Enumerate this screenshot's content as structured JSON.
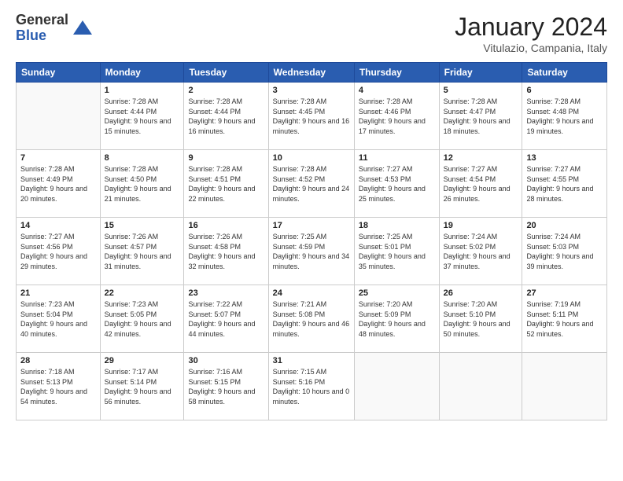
{
  "logo": {
    "general": "General",
    "blue": "Blue"
  },
  "title": "January 2024",
  "subtitle": "Vitulazio, Campania, Italy",
  "headers": [
    "Sunday",
    "Monday",
    "Tuesday",
    "Wednesday",
    "Thursday",
    "Friday",
    "Saturday"
  ],
  "weeks": [
    [
      {
        "num": "",
        "sunrise": "",
        "sunset": "",
        "daylight": ""
      },
      {
        "num": "1",
        "sunrise": "Sunrise: 7:28 AM",
        "sunset": "Sunset: 4:44 PM",
        "daylight": "Daylight: 9 hours and 15 minutes."
      },
      {
        "num": "2",
        "sunrise": "Sunrise: 7:28 AM",
        "sunset": "Sunset: 4:44 PM",
        "daylight": "Daylight: 9 hours and 16 minutes."
      },
      {
        "num": "3",
        "sunrise": "Sunrise: 7:28 AM",
        "sunset": "Sunset: 4:45 PM",
        "daylight": "Daylight: 9 hours and 16 minutes."
      },
      {
        "num": "4",
        "sunrise": "Sunrise: 7:28 AM",
        "sunset": "Sunset: 4:46 PM",
        "daylight": "Daylight: 9 hours and 17 minutes."
      },
      {
        "num": "5",
        "sunrise": "Sunrise: 7:28 AM",
        "sunset": "Sunset: 4:47 PM",
        "daylight": "Daylight: 9 hours and 18 minutes."
      },
      {
        "num": "6",
        "sunrise": "Sunrise: 7:28 AM",
        "sunset": "Sunset: 4:48 PM",
        "daylight": "Daylight: 9 hours and 19 minutes."
      }
    ],
    [
      {
        "num": "7",
        "sunrise": "Sunrise: 7:28 AM",
        "sunset": "Sunset: 4:49 PM",
        "daylight": "Daylight: 9 hours and 20 minutes."
      },
      {
        "num": "8",
        "sunrise": "Sunrise: 7:28 AM",
        "sunset": "Sunset: 4:50 PM",
        "daylight": "Daylight: 9 hours and 21 minutes."
      },
      {
        "num": "9",
        "sunrise": "Sunrise: 7:28 AM",
        "sunset": "Sunset: 4:51 PM",
        "daylight": "Daylight: 9 hours and 22 minutes."
      },
      {
        "num": "10",
        "sunrise": "Sunrise: 7:28 AM",
        "sunset": "Sunset: 4:52 PM",
        "daylight": "Daylight: 9 hours and 24 minutes."
      },
      {
        "num": "11",
        "sunrise": "Sunrise: 7:27 AM",
        "sunset": "Sunset: 4:53 PM",
        "daylight": "Daylight: 9 hours and 25 minutes."
      },
      {
        "num": "12",
        "sunrise": "Sunrise: 7:27 AM",
        "sunset": "Sunset: 4:54 PM",
        "daylight": "Daylight: 9 hours and 26 minutes."
      },
      {
        "num": "13",
        "sunrise": "Sunrise: 7:27 AM",
        "sunset": "Sunset: 4:55 PM",
        "daylight": "Daylight: 9 hours and 28 minutes."
      }
    ],
    [
      {
        "num": "14",
        "sunrise": "Sunrise: 7:27 AM",
        "sunset": "Sunset: 4:56 PM",
        "daylight": "Daylight: 9 hours and 29 minutes."
      },
      {
        "num": "15",
        "sunrise": "Sunrise: 7:26 AM",
        "sunset": "Sunset: 4:57 PM",
        "daylight": "Daylight: 9 hours and 31 minutes."
      },
      {
        "num": "16",
        "sunrise": "Sunrise: 7:26 AM",
        "sunset": "Sunset: 4:58 PM",
        "daylight": "Daylight: 9 hours and 32 minutes."
      },
      {
        "num": "17",
        "sunrise": "Sunrise: 7:25 AM",
        "sunset": "Sunset: 4:59 PM",
        "daylight": "Daylight: 9 hours and 34 minutes."
      },
      {
        "num": "18",
        "sunrise": "Sunrise: 7:25 AM",
        "sunset": "Sunset: 5:01 PM",
        "daylight": "Daylight: 9 hours and 35 minutes."
      },
      {
        "num": "19",
        "sunrise": "Sunrise: 7:24 AM",
        "sunset": "Sunset: 5:02 PM",
        "daylight": "Daylight: 9 hours and 37 minutes."
      },
      {
        "num": "20",
        "sunrise": "Sunrise: 7:24 AM",
        "sunset": "Sunset: 5:03 PM",
        "daylight": "Daylight: 9 hours and 39 minutes."
      }
    ],
    [
      {
        "num": "21",
        "sunrise": "Sunrise: 7:23 AM",
        "sunset": "Sunset: 5:04 PM",
        "daylight": "Daylight: 9 hours and 40 minutes."
      },
      {
        "num": "22",
        "sunrise": "Sunrise: 7:23 AM",
        "sunset": "Sunset: 5:05 PM",
        "daylight": "Daylight: 9 hours and 42 minutes."
      },
      {
        "num": "23",
        "sunrise": "Sunrise: 7:22 AM",
        "sunset": "Sunset: 5:07 PM",
        "daylight": "Daylight: 9 hours and 44 minutes."
      },
      {
        "num": "24",
        "sunrise": "Sunrise: 7:21 AM",
        "sunset": "Sunset: 5:08 PM",
        "daylight": "Daylight: 9 hours and 46 minutes."
      },
      {
        "num": "25",
        "sunrise": "Sunrise: 7:20 AM",
        "sunset": "Sunset: 5:09 PM",
        "daylight": "Daylight: 9 hours and 48 minutes."
      },
      {
        "num": "26",
        "sunrise": "Sunrise: 7:20 AM",
        "sunset": "Sunset: 5:10 PM",
        "daylight": "Daylight: 9 hours and 50 minutes."
      },
      {
        "num": "27",
        "sunrise": "Sunrise: 7:19 AM",
        "sunset": "Sunset: 5:11 PM",
        "daylight": "Daylight: 9 hours and 52 minutes."
      }
    ],
    [
      {
        "num": "28",
        "sunrise": "Sunrise: 7:18 AM",
        "sunset": "Sunset: 5:13 PM",
        "daylight": "Daylight: 9 hours and 54 minutes."
      },
      {
        "num": "29",
        "sunrise": "Sunrise: 7:17 AM",
        "sunset": "Sunset: 5:14 PM",
        "daylight": "Daylight: 9 hours and 56 minutes."
      },
      {
        "num": "30",
        "sunrise": "Sunrise: 7:16 AM",
        "sunset": "Sunset: 5:15 PM",
        "daylight": "Daylight: 9 hours and 58 minutes."
      },
      {
        "num": "31",
        "sunrise": "Sunrise: 7:15 AM",
        "sunset": "Sunset: 5:16 PM",
        "daylight": "Daylight: 10 hours and 0 minutes."
      },
      {
        "num": "",
        "sunrise": "",
        "sunset": "",
        "daylight": ""
      },
      {
        "num": "",
        "sunrise": "",
        "sunset": "",
        "daylight": ""
      },
      {
        "num": "",
        "sunrise": "",
        "sunset": "",
        "daylight": ""
      }
    ]
  ]
}
